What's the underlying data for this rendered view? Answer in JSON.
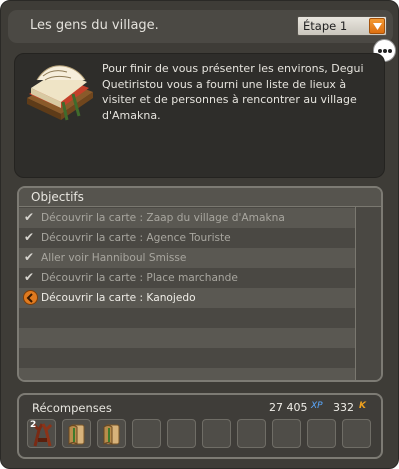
{
  "window": {
    "title": "Les gens du village.",
    "stage_select": {
      "selected": "Étape 1"
    }
  },
  "description": {
    "text": "Pour finir de vous présenter les environs, Degui Quetiristou vous a fourni une liste de lieux à visiter et de personnes à rencontrer au village d'Amakna."
  },
  "objectives": {
    "header": "Objectifs",
    "items": [
      {
        "label": "Découvrir la carte : Zaap du village d'Amakna",
        "done": true
      },
      {
        "label": "Découvrir la carte : Agence Touriste",
        "done": true
      },
      {
        "label": "Aller voir Hanniboul Smisse",
        "done": true
      },
      {
        "label": "Découvrir la carte : Place marchande",
        "done": true
      },
      {
        "label": "Découvrir la carte : Kanojedo",
        "done": false
      }
    ]
  },
  "rewards": {
    "label": "Récompenses",
    "xp_value": "27 405",
    "xp_unit": "XP",
    "kamas_value": "332",
    "kamas_unit": "K",
    "items": [
      {
        "icon": "antlers-item-icon",
        "quantity": "2"
      },
      {
        "icon": "scroll-item-icon"
      },
      {
        "icon": "scroll-item-icon"
      }
    ],
    "slot_count": 10
  },
  "colors": {
    "accent_orange": "#e07a1f",
    "xp_blue": "#5aa9ff",
    "kamas_orange": "#f0a21e"
  }
}
